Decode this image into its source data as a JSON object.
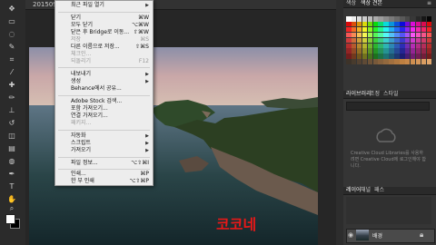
{
  "document": {
    "tab_title": "20150908_..."
  },
  "menu": {
    "items": [
      {
        "label": "최근 파일 열기",
        "shortcut": "",
        "disabled": false,
        "submenu": true
      },
      {
        "label": "닫기",
        "shortcut": "⌘W",
        "disabled": false,
        "submenu": false
      },
      {
        "label": "모두 닫기",
        "shortcut": "⌥⌘W",
        "disabled": false,
        "submenu": false
      },
      {
        "label": "닫은 후 Bridge로 이동...",
        "shortcut": "⇧⌘W",
        "disabled": false,
        "submenu": false
      },
      {
        "label": "저장",
        "shortcut": "⌘S",
        "disabled": true,
        "submenu": false
      },
      {
        "label": "다른 이름으로 저장...",
        "shortcut": "⇧⌘S",
        "disabled": false,
        "submenu": false
      },
      {
        "label": "체크인...",
        "shortcut": "",
        "disabled": true,
        "submenu": false
      },
      {
        "label": "되돌리기",
        "shortcut": "F12",
        "disabled": true,
        "submenu": false
      },
      {
        "label": "내보내기",
        "shortcut": "",
        "disabled": false,
        "submenu": true
      },
      {
        "label": "생성",
        "shortcut": "",
        "disabled": false,
        "submenu": true
      },
      {
        "label": "Behance에서 공유...",
        "shortcut": "",
        "disabled": false,
        "submenu": false
      },
      {
        "label": "Adobe Stock 검색...",
        "shortcut": "",
        "disabled": false,
        "submenu": false
      },
      {
        "label": "포함 가져오기...",
        "shortcut": "",
        "disabled": false,
        "submenu": false
      },
      {
        "label": "연결 가져오기...",
        "shortcut": "",
        "disabled": false,
        "submenu": false
      },
      {
        "label": "패키지...",
        "shortcut": "",
        "disabled": true,
        "submenu": false
      },
      {
        "label": "자동화",
        "shortcut": "",
        "disabled": false,
        "submenu": true
      },
      {
        "label": "스크립트",
        "shortcut": "",
        "disabled": false,
        "submenu": true
      },
      {
        "label": "가져오기",
        "shortcut": "",
        "disabled": false,
        "submenu": true
      },
      {
        "label": "파일 정보...",
        "shortcut": "⌥⇧⌘I",
        "disabled": false,
        "submenu": false
      },
      {
        "label": "인쇄...",
        "shortcut": "⌘P",
        "disabled": false,
        "submenu": false
      },
      {
        "label": "한 부 인쇄",
        "shortcut": "⌥⇧⌘P",
        "disabled": false,
        "submenu": false
      }
    ]
  },
  "panels": {
    "swatches_tabs": [
      "색상",
      "색상 견본"
    ],
    "library_tabs": [
      "라이브러리",
      "조정",
      "스타일"
    ],
    "library_message": "Creative Cloud Libraries를 사용하려면 Creative Cloud에 로그인해야 합니다.",
    "layers_tabs": [
      "레이어",
      "채널",
      "패스"
    ],
    "layer_name": "배경"
  },
  "watermark": "코코네",
  "colors": {
    "accent_red": "#e81818",
    "menu_bg": "#ededed",
    "panel_bg": "#353535"
  }
}
